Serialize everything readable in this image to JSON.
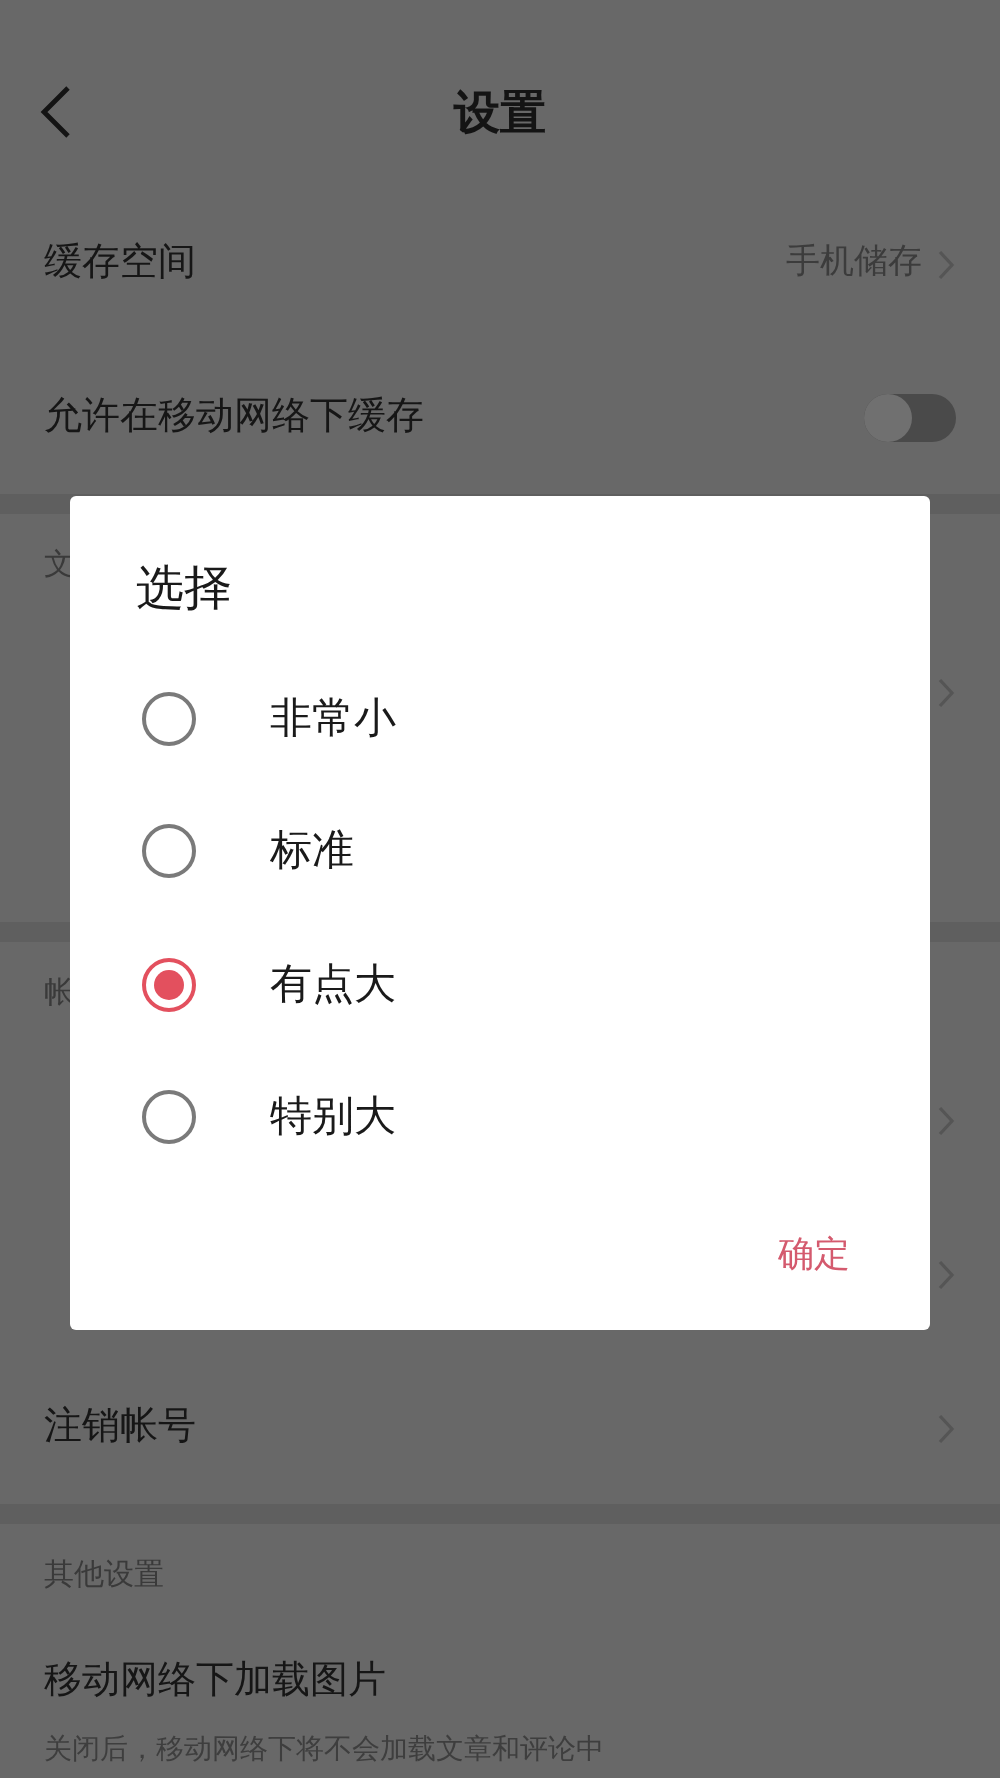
{
  "header": {
    "title": "设置"
  },
  "sections": [
    {
      "rows": [
        {
          "kind": "value",
          "label": "缓存空间",
          "value": "手机储存"
        },
        {
          "kind": "toggle",
          "label": "允许在移动网络下缓存",
          "on": false
        }
      ]
    },
    {
      "header": "文",
      "rows": [
        {
          "kind": "link"
        },
        {
          "kind": "plain"
        }
      ]
    },
    {
      "header": "帐",
      "rows": [
        {
          "kind": "link"
        },
        {
          "kind": "link"
        },
        {
          "kind": "link",
          "label": "注销帐号"
        }
      ]
    },
    {
      "header": "其他设置",
      "rows": [
        {
          "kind": "desc",
          "label": "移动网络下加载图片",
          "description": "关闭后，移动网络下将不会加载文章和评论中"
        }
      ]
    }
  ],
  "dialog": {
    "title": "选择",
    "options": [
      {
        "label": "非常小",
        "selected": false
      },
      {
        "label": "标准",
        "selected": false
      },
      {
        "label": "有点大",
        "selected": true
      },
      {
        "label": "特别大",
        "selected": false
      }
    ],
    "confirm": "确定"
  }
}
